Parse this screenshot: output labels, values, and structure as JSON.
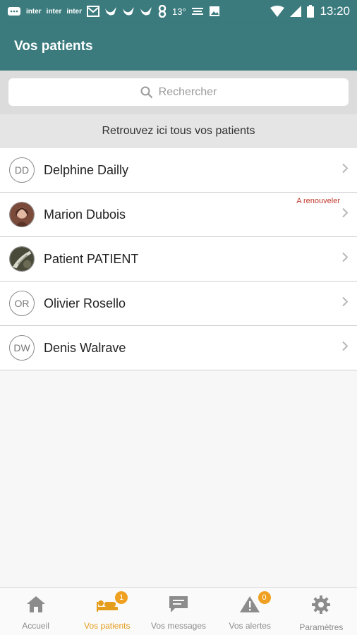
{
  "status_bar": {
    "left_labels": [
      "inter",
      "inter",
      "inter"
    ],
    "temperature": "13°",
    "time": "13:20"
  },
  "appbar": {
    "title": "Vos patients"
  },
  "search": {
    "placeholder": "Rechercher"
  },
  "info_text": "Retrouvez ici tous vos patients",
  "patients": [
    {
      "initials": "DD",
      "name": "Delphine Dailly",
      "badge": ""
    },
    {
      "initials": "",
      "name": "Marion Dubois",
      "badge": "A renouveler"
    },
    {
      "initials": "",
      "name": "Patient PATIENT",
      "badge": ""
    },
    {
      "initials": "OR",
      "name": "Olivier Rosello",
      "badge": ""
    },
    {
      "initials": "DW",
      "name": "Denis Walrave",
      "badge": ""
    }
  ],
  "nav": [
    {
      "label": "Accueil",
      "icon": "home-icon",
      "count": ""
    },
    {
      "label": "Vos patients",
      "icon": "patient-bed-icon",
      "count": "1"
    },
    {
      "label": "Vos messages",
      "icon": "message-icon",
      "count": ""
    },
    {
      "label": "Vos alertes",
      "icon": "alert-icon",
      "count": "0"
    },
    {
      "label": "Paramètres",
      "icon": "gear-icon",
      "count": ""
    }
  ],
  "colors": {
    "primary": "#3b7b7e",
    "accent": "#e49d1d",
    "badge": "#c0392b"
  }
}
